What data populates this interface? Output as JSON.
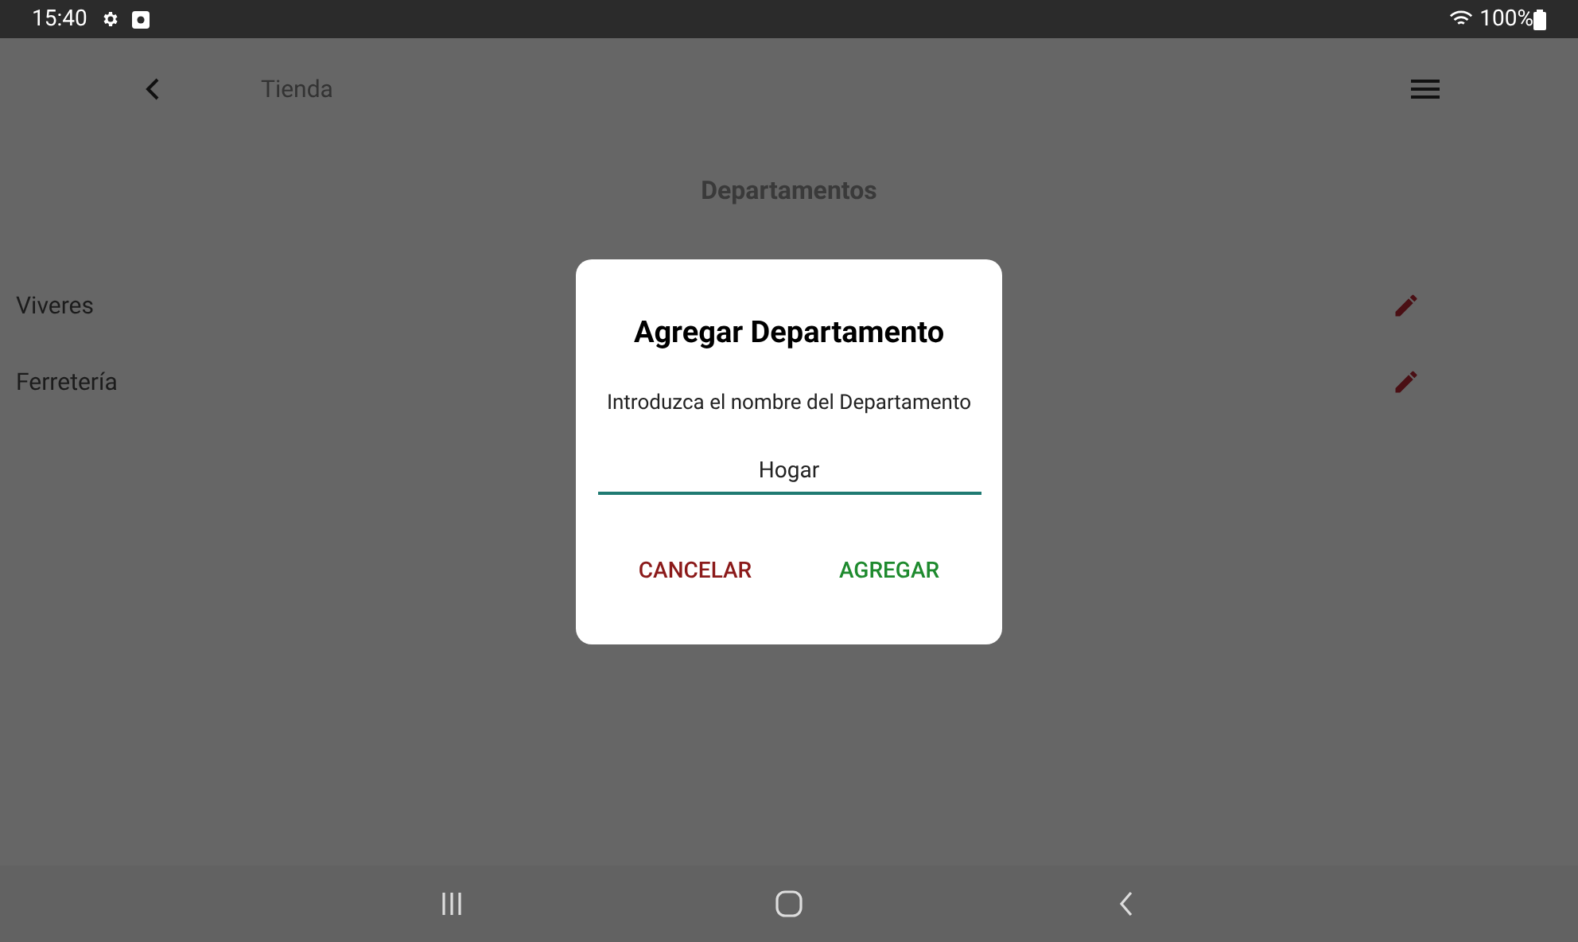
{
  "status_bar": {
    "time": "15:40",
    "battery": "100%"
  },
  "app_bar": {
    "title": "Tienda"
  },
  "page": {
    "heading": "Departamentos",
    "departments": [
      {
        "name": "Viveres"
      },
      {
        "name": "Ferretería"
      }
    ]
  },
  "dialog": {
    "title": "Agregar Departamento",
    "message": "Introduzca el nombre del Departamento",
    "input": {
      "value": "Hogar"
    },
    "buttons": [
      {
        "label": "CANCELAR",
        "kind": "cancel"
      },
      {
        "label": "AGREGAR",
        "kind": "confirm"
      }
    ]
  }
}
